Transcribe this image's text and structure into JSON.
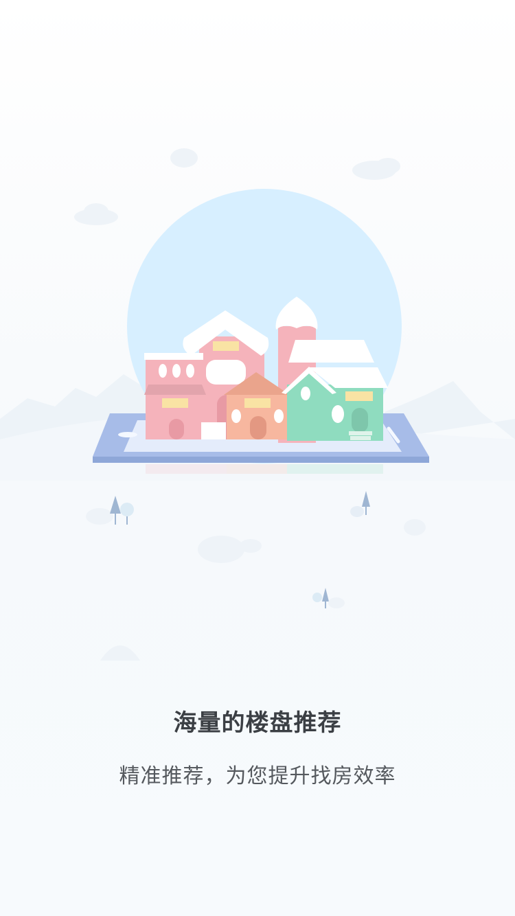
{
  "onboarding": {
    "title": "海量的楼盘推荐",
    "subtitle": "精准推荐，为您提升找房效率"
  },
  "colors": {
    "sun": "#d7efff",
    "pink": "#f5b3bb",
    "peach": "#f7b79f",
    "green": "#8fdcbf",
    "tablet": "#a7bce8",
    "snow": "#ffffff",
    "title": "#3b3f44",
    "subtitle": "#55595e"
  },
  "icons": [
    "house-illustration-icon",
    "tablet-icon",
    "cloud-icon",
    "tree-icon"
  ]
}
